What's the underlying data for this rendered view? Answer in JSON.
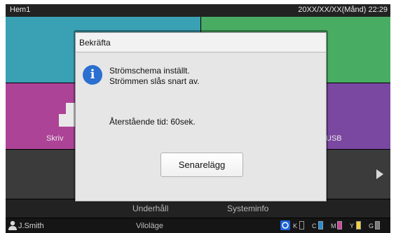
{
  "topbar": {
    "home": "Hem1",
    "datetime": "20XX/XX/XX(Månd) 22:29"
  },
  "tiles": {
    "print_label": "Skriv",
    "usb_label": "USB"
  },
  "menubar": {
    "maintenance": "Underhåll",
    "sysinfo": "Systeminfo"
  },
  "statusbar": {
    "user": "J.Smith",
    "mode": "Viloläge",
    "inks": [
      {
        "label": "K",
        "color": "#2a2a2a",
        "level": 0.0
      },
      {
        "label": "C",
        "color": "#1e8fd6",
        "level": 1.0
      },
      {
        "label": "M",
        "color": "#d3459c",
        "level": 1.0
      },
      {
        "label": "Y",
        "color": "#f2d43a",
        "level": 1.0
      },
      {
        "label": "G",
        "color": "#7a7a7a",
        "level": 1.0
      }
    ]
  },
  "dialog": {
    "title": "Bekräfta",
    "message_line1": "Strömschema inställt.",
    "message_line2": "Strömmen slås snart av.",
    "remaining": "Återstående tid: 60sek.",
    "button": "Senarelägg",
    "icon": "info-icon"
  },
  "colors": {
    "teal": "#3aa0b3",
    "green": "#49ac63",
    "magenta": "#ad4397",
    "purple": "#7a47a1",
    "info_blue": "#2b6fd0"
  }
}
